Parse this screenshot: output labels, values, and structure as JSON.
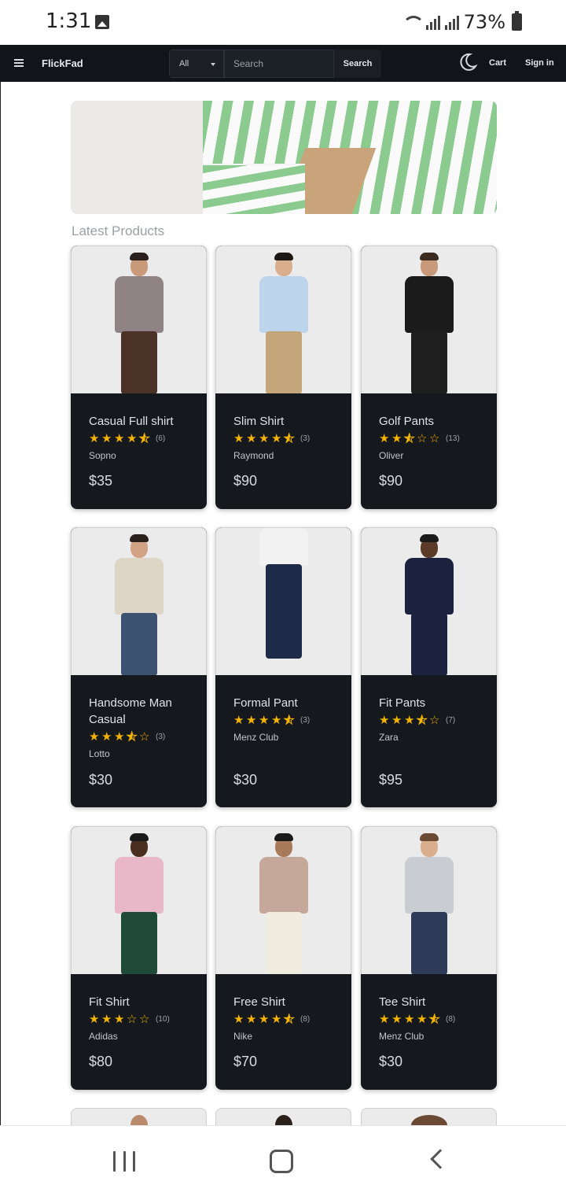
{
  "status_bar": {
    "time": "1:31",
    "battery": "73%"
  },
  "navbar": {
    "brand": "FlickFad",
    "search_category": "All",
    "search_placeholder": "Search",
    "search_button": "Search",
    "theme_icon": "moon-icon",
    "cart_label": "Cart",
    "signin_label": "Sign in"
  },
  "section_title": "Latest Products",
  "products": [
    {
      "title": "Casual Full shirt",
      "rating": 4.5,
      "stars": [
        "full",
        "full",
        "full",
        "full",
        "half"
      ],
      "reviews": "(6)",
      "brand": "Sopno",
      "price": "$35"
    },
    {
      "title": "Slim Shirt",
      "rating": 4.5,
      "stars": [
        "full",
        "full",
        "full",
        "full",
        "half"
      ],
      "reviews": "(3)",
      "brand": "Raymond",
      "price": "$90"
    },
    {
      "title": "Golf Pants",
      "rating": 2.5,
      "stars": [
        "full",
        "full",
        "half",
        "empty",
        "empty"
      ],
      "reviews": "(13)",
      "brand": "Oliver",
      "price": "$90"
    },
    {
      "title": "Handsome Man Casual",
      "rating": 3.5,
      "stars": [
        "full",
        "full",
        "full",
        "half",
        "empty"
      ],
      "reviews": "(3)",
      "brand": "Lotto",
      "price": "$30"
    },
    {
      "title": "Formal Pant",
      "rating": 4.5,
      "stars": [
        "full",
        "full",
        "full",
        "full",
        "half"
      ],
      "reviews": "(3)",
      "brand": "Menz Club",
      "price": "$30"
    },
    {
      "title": "Fit Pants",
      "rating": 3.5,
      "stars": [
        "full",
        "full",
        "full",
        "half",
        "empty"
      ],
      "reviews": "(7)",
      "brand": "Zara",
      "price": "$95"
    },
    {
      "title": "Fit Shirt",
      "rating": 3,
      "stars": [
        "full",
        "full",
        "full",
        "empty",
        "empty"
      ],
      "reviews": "(10)",
      "brand": "Adidas",
      "price": "$80"
    },
    {
      "title": "Free Shirt",
      "rating": 4.5,
      "stars": [
        "full",
        "full",
        "full",
        "full",
        "half"
      ],
      "reviews": "(8)",
      "brand": "Nike",
      "price": "$70"
    },
    {
      "title": "Tee Shirt",
      "rating": 4.5,
      "stars": [
        "full",
        "full",
        "full",
        "full",
        "half"
      ],
      "reviews": "(8)",
      "brand": "Menz Club",
      "price": "$30"
    }
  ],
  "colors": {
    "nav_bg": "#111418",
    "card_bg": "#15181d",
    "star": "#f4b400",
    "hero_stripe": "#8ccb8f"
  }
}
